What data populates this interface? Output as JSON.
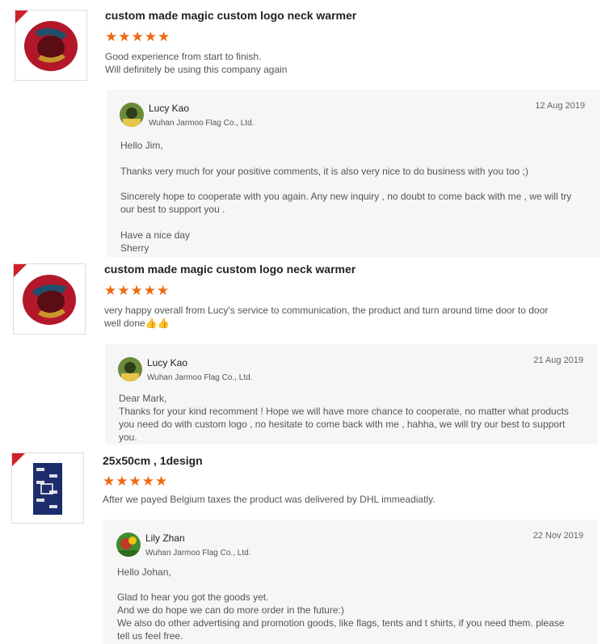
{
  "reviews": [
    {
      "title": "custom made magic custom logo neck warmer",
      "stars": "★★★★★",
      "comment_lines": [
        "Good experience from start to finish.",
        "Will definitely be using this company again"
      ],
      "reply": {
        "name": "Lucy Kao",
        "company": "Wuhan Jarmoo Flag Co., Ltd.",
        "date": "12 Aug 2019",
        "lines": [
          "Hello Jim,",
          "Thanks very much for your positive comments, it is also very nice to do business with you too ;)",
          "Sincerely hope to cooperate with you again.  Any new inquiry , no doubt to come back with me , we will try",
          "our best to support you .",
          "Have a nice day",
          "Sherry"
        ]
      }
    },
    {
      "title": "custom made magic custom logo neck warmer",
      "stars": "★★★★★",
      "comment_lines": [
        "very happy overall from Lucy's service to communication, the product and turn around time door to door",
        "well done👍👍"
      ],
      "reply": {
        "name": "Lucy Kao",
        "company": "Wuhan Jarmoo Flag Co., Ltd.",
        "date": "21 Aug 2019",
        "lines": [
          "Dear Mark,",
          "Thanks for your kind recomment !  Hope we will have more chance to cooperate, no matter what products",
          "you need do with custom logo , no hesitate to come back with me , hahha, we will try our best to support",
          "you."
        ]
      }
    },
    {
      "title": "25x50cm , 1design",
      "stars": "★★★★★",
      "comment_lines": [
        "After we payed Belgium taxes the product was delivered by DHL immeadiatly."
      ],
      "reply": {
        "name": "Lily Zhan",
        "company": "Wuhan Jarmoo Flag Co., Ltd.",
        "date": "22 Nov 2019",
        "lines": [
          "Hello Johan,",
          "Glad to hear you got the goods yet.",
          "And we do hope we can do more order in the future:)",
          "We also do other advertising and promotion goods, like flags, tents and t shirts, if you need them. please",
          "tell us feel free."
        ]
      }
    }
  ]
}
